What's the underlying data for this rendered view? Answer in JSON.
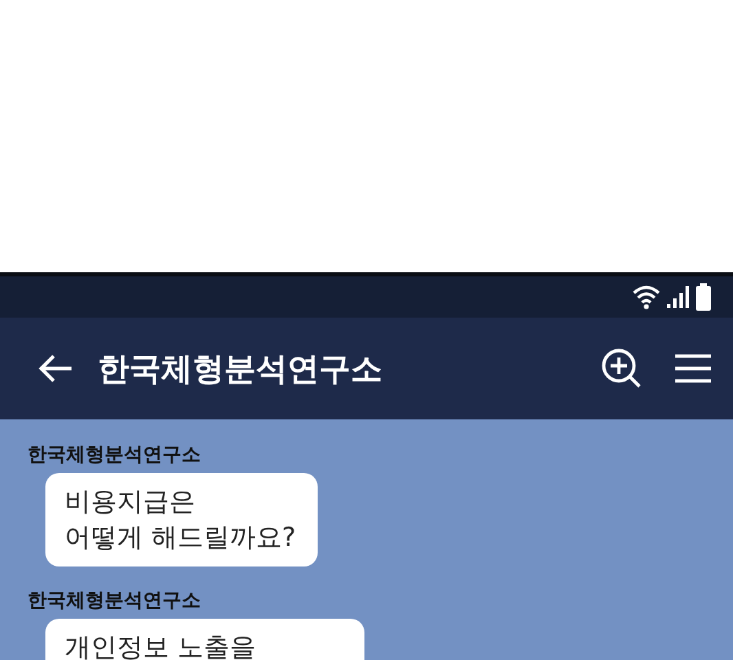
{
  "chat_room": {
    "title": "한국체형분석연구소"
  },
  "messages": [
    {
      "sender": "한국체형분석연구소",
      "lines": [
        "비용지급은",
        "어떻게 해드릴까요?"
      ]
    },
    {
      "sender": "한국체형분석연구소",
      "lines": [
        "개인정보 노출을"
      ]
    }
  ]
}
